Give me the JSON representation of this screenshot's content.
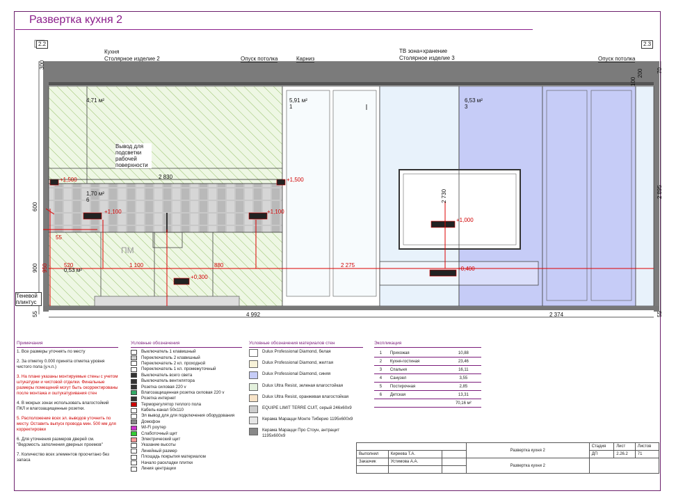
{
  "sheet_title": "Развертка кухня 2",
  "marks": {
    "left": "2.2",
    "right": "2.3"
  },
  "labels": {
    "kitchen_line1": "Кухня",
    "kitchen_line2": "Столярное изделие 2",
    "ceiling_drop_left": "Опуск потолка",
    "cornice": "Карниз",
    "tv_line1": "ТВ зона+хранение",
    "tv_line2": "Столярное изделие 3",
    "ceiling_drop_right": "Опуск потолка",
    "light_outlet": "Вывод для подсветки рабочей поверхности",
    "shadow_plinth": "Теневой плинтус",
    "pm": "ПМ"
  },
  "areas": {
    "a1_value": "4,71 м²",
    "a2_value": "5,91 м²",
    "a2_num": "1",
    "a3_value": "6,53 м²",
    "a3_num": "3",
    "a4_value": "1,70 м²",
    "a4_num": "6",
    "a5_value": "0,53 м²"
  },
  "heights": {
    "h1": "+1,500",
    "h2": "+1,500",
    "h3": "+1,100",
    "h4": "+1,100",
    "h5": "+0,300",
    "h6": "+1,000",
    "h7": "+0,400"
  },
  "dims": {
    "left_300": "300",
    "left_600": "600",
    "left_900": "900",
    "left_55": "55",
    "left_950": "950",
    "left_55b": "55",
    "top_2830": "2 830",
    "d520": "520",
    "d1100": "1 100",
    "d880": "880",
    "d2275": "2 275",
    "d2730": "2 730",
    "bottom_4992": "4 992",
    "bottom_2374": "2 374",
    "right_2895": "2 895",
    "right_70": "70",
    "right_100": "100",
    "right_200": "200",
    "right_55": "55"
  },
  "notes": {
    "title": "Примечания",
    "items": [
      {
        "text": "1. Все размеры уточнять по месту",
        "red": false
      },
      {
        "text": "2. За отметку 0.000 принята отметка уровня чистого пола (у.ч.п.)",
        "red": false
      },
      {
        "text": "3. На плане указаны монтируемые стены с учетом штукатурки и чистовой отделки. Финальные размеры помещений могут быть скорректированы после монтажа и оштукатуривания стен",
        "red": true
      },
      {
        "text": "4. В мокрых зонах использовать влагостойкий ПКЛ и влагозащищенные розетки.",
        "red": false
      },
      {
        "text": "5. Расположение всех эл. выводов уточнить по месту. Оставить выпуск провода мин. 500 мм для корректировки",
        "red": true
      },
      {
        "text": "6. Для уточнения размеров дверей см. \"Ведомость заполнения дверных проемов\"",
        "red": false
      },
      {
        "text": "7. Количество всех элементов просчитано без запаса",
        "red": false
      }
    ]
  },
  "legend": {
    "title": "Условные обозначения",
    "items": [
      "Выключатель 1 клавишный",
      "Переключатель 2 клавишный",
      "Переключатель 2 кл. проходной",
      "Переключатель 1 кл. промежуточный",
      "Выключатель всего света",
      "Выключатель вентилятора",
      "Розетка силовая 220 v",
      "Влагозащищенная розетка силовая 220 v",
      "Розетка интернет",
      "Терморегулятор теплого пола",
      "Кабель-канал 50х110",
      "Эл вывод для для подключения оборудования",
      "Домофон",
      "Wi-Fi роутер",
      "Слаботочный щит",
      "Электрический щит",
      "Указание высоты",
      "Линейный размер",
      "Площадь покрытия материалом",
      "Начало раскладки плитки",
      "Линия центрации"
    ],
    "sample_height": "+0,50",
    "sample_dim": "123",
    "sample_area": "7,60 м²"
  },
  "materials": {
    "title": "Условные обозначения материалов стен",
    "items": [
      {
        "name": "Dulux Professional Diamond, белая",
        "color": "#ffffff"
      },
      {
        "name": "Dulux Professional Diamond, желтая",
        "color": "#f7f2d8"
      },
      {
        "name": "Dulux Professional Diamond, синяя",
        "color": "#c6ccf7"
      },
      {
        "name": "Dulux Ultra Resist, зеленая влагостойкая",
        "color": "#e3f0dc"
      },
      {
        "name": "Dulux Ultra Resist, оранжевая влагостойкая",
        "color": "#f7e3c8"
      },
      {
        "name": "EQUIPE LIMIT TERRE CUIT, серый 246х60х9",
        "color": "#cccccc"
      },
      {
        "name": "Керама Марацци Монте Тиберио 1195х600х9",
        "color": "#e6e6e6"
      },
      {
        "name": "Керама Марацци Про Стоун, антрацит 1195х600х9",
        "color": "#888888"
      }
    ]
  },
  "explication": {
    "title": "Экспликация",
    "rows": [
      [
        "1",
        "Прихожая",
        "10,88"
      ],
      [
        "2",
        "Кухня-гостиная",
        "23,46"
      ],
      [
        "3",
        "Спальня",
        "16,11"
      ],
      [
        "4",
        "Санузел",
        "3,55"
      ],
      [
        "5",
        "Постирочная",
        "2,85"
      ],
      [
        "6",
        "Детская",
        "13,31"
      ]
    ],
    "total": "70,16 м²"
  },
  "stamp": {
    "performed_label": "Выполнил",
    "performed_name": "Киреева Т.А.",
    "customer_label": "Заказчик",
    "customer_name": "Устимова А.А.",
    "sheet_name_1": "Развертка кухня 2",
    "sheet_name_2": "Развертка кухни 2",
    "stage_label": "Стадия",
    "stage_value": "ДП",
    "sheet_label": "Лист",
    "sheet_value": "2.26.2",
    "sheets_label": "Листов",
    "sheets_value": "71"
  }
}
